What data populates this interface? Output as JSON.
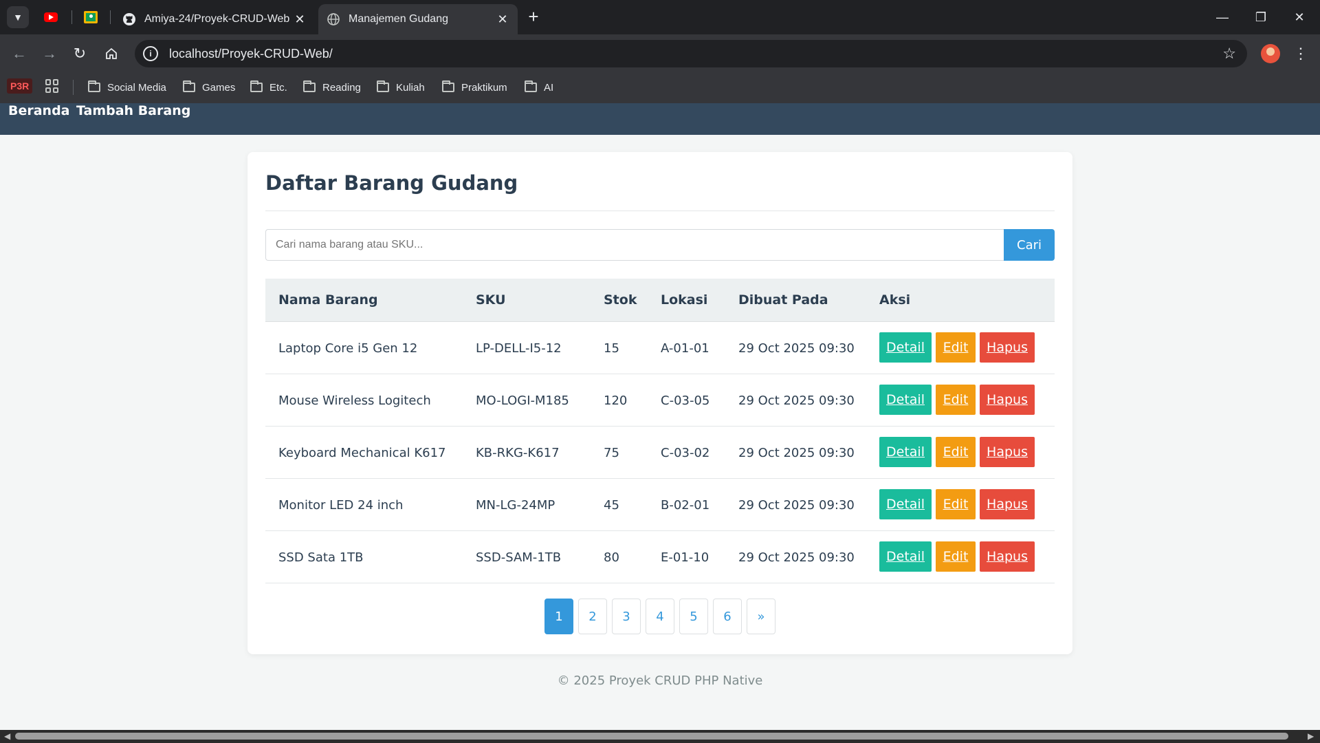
{
  "browser": {
    "tabs": [
      {
        "title": "Amiya-24/Proyek-CRUD-Web",
        "icon": "github-icon"
      },
      {
        "title": "Manajemen Gudang",
        "icon": "globe-icon"
      }
    ],
    "url": "localhost/Proyek-CRUD-Web/",
    "bookmarks": {
      "p3r_label": "P3R",
      "folders": [
        "Social Media",
        "Games",
        "Etc.",
        "Reading",
        "Kuliah",
        "Praktikum",
        "AI"
      ]
    }
  },
  "nav": {
    "links": [
      "Beranda",
      "Tambah Barang"
    ]
  },
  "page": {
    "title": "Daftar Barang Gudang",
    "search": {
      "placeholder": "Cari nama barang atau SKU...",
      "value": "",
      "button_label": "Cari"
    },
    "table": {
      "headers": [
        "Nama Barang",
        "SKU",
        "Stok",
        "Lokasi",
        "Dibuat Pada",
        "Aksi"
      ],
      "rows": [
        {
          "nama": "Laptop Core i5 Gen 12",
          "sku": "LP-DELL-I5-12",
          "stok": "15",
          "lokasi": "A-01-01",
          "dibuat": "29 Oct 2025 09:30"
        },
        {
          "nama": "Mouse Wireless Logitech",
          "sku": "MO-LOGI-M185",
          "stok": "120",
          "lokasi": "C-03-05",
          "dibuat": "29 Oct 2025 09:30"
        },
        {
          "nama": "Keyboard Mechanical K617",
          "sku": "KB-RKG-K617",
          "stok": "75",
          "lokasi": "C-03-02",
          "dibuat": "29 Oct 2025 09:30"
        },
        {
          "nama": "Monitor LED 24 inch",
          "sku": "MN-LG-24MP",
          "stok": "45",
          "lokasi": "B-02-01",
          "dibuat": "29 Oct 2025 09:30"
        },
        {
          "nama": "SSD Sata 1TB",
          "sku": "SSD-SAM-1TB",
          "stok": "80",
          "lokasi": "E-01-10",
          "dibuat": "29 Oct 2025 09:30"
        }
      ],
      "actions": {
        "detail": "Detail",
        "edit": "Edit",
        "hapus": "Hapus"
      }
    },
    "pagination": {
      "pages": [
        "1",
        "2",
        "3",
        "4",
        "5",
        "6"
      ],
      "next": "»",
      "current": "1"
    }
  },
  "footer": {
    "text": "© 2025 Proyek CRUD PHP Native"
  },
  "colors": {
    "nav_bg": "#34495e",
    "primary": "#3498db",
    "detail": "#1abc9c",
    "edit": "#f39c12",
    "hapus": "#e74c3c",
    "heading": "#2c3e50"
  }
}
